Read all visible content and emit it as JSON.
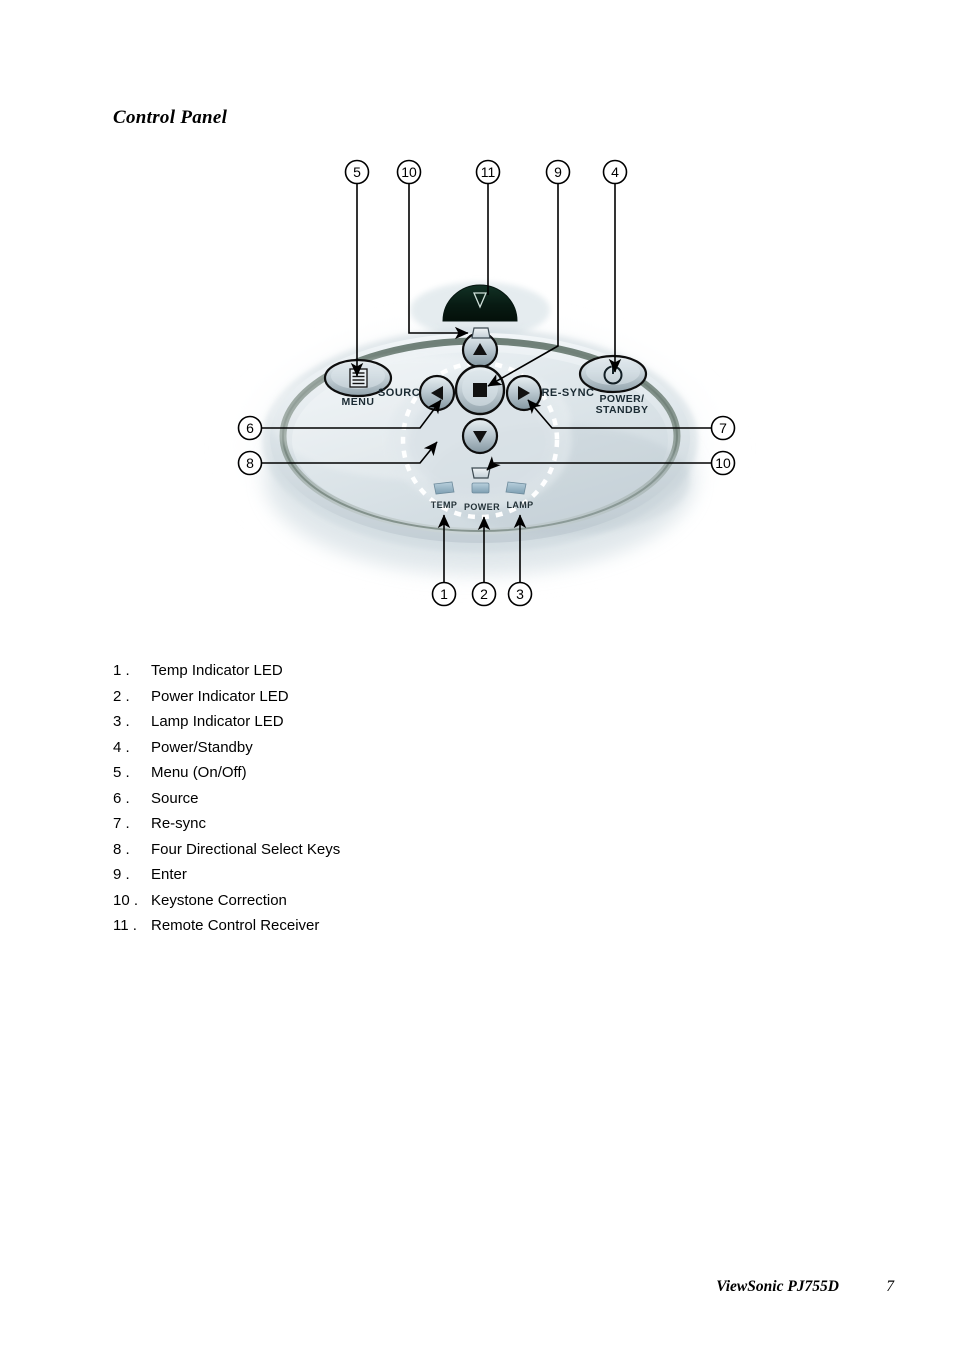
{
  "page": {
    "title": "Control Panel"
  },
  "figure": {
    "name": "projector-control-panel-diagram",
    "panel_labels": {
      "menu": "MENU",
      "source": "SOURCE",
      "resync": "RE-SYNC",
      "power_standby_line1": "POWER/",
      "power_standby_line2": "STANDBY",
      "led_temp": "TEMP",
      "led_power": "POWER",
      "led_lamp": "LAMP"
    },
    "callouts": {
      "top": [
        "5",
        "10",
        "11",
        "9",
        "4"
      ],
      "left": [
        "6",
        "8"
      ],
      "right": [
        "7",
        "10"
      ],
      "bottom": [
        "1",
        "2",
        "3"
      ]
    },
    "colors": {
      "panel_body": "#dfe6ea",
      "panel_rim": "#7f8f88",
      "panel_edge": "#b9c6cc",
      "dome": "#0d2119",
      "button_face": "#c3ced4",
      "button_outline": "#1a1a1a",
      "led": "#96b3c4",
      "callout_line": "#000000",
      "dashed_ring": "#ffffff"
    }
  },
  "items": [
    {
      "num": "1 .",
      "label": "Temp Indicator LED"
    },
    {
      "num": "2 .",
      "label": "Power Indicator LED"
    },
    {
      "num": "3 .",
      "label": "Lamp Indicator LED"
    },
    {
      "num": "4 .",
      "label": "Power/Standby"
    },
    {
      "num": "5 .",
      "label": "Menu (On/Off)"
    },
    {
      "num": "6 .",
      "label": "Source"
    },
    {
      "num": "7 .",
      "label": "Re-sync"
    },
    {
      "num": "8 .",
      "label": "Four Directional Select Keys"
    },
    {
      "num": "9 .",
      "label": "Enter"
    },
    {
      "num": "10 .",
      "label": "Keystone Correction"
    },
    {
      "num": "11 .",
      "label": "Remote Control Receiver"
    }
  ],
  "footer": {
    "brand": "ViewSonic PJ755D",
    "page_number": "7"
  }
}
